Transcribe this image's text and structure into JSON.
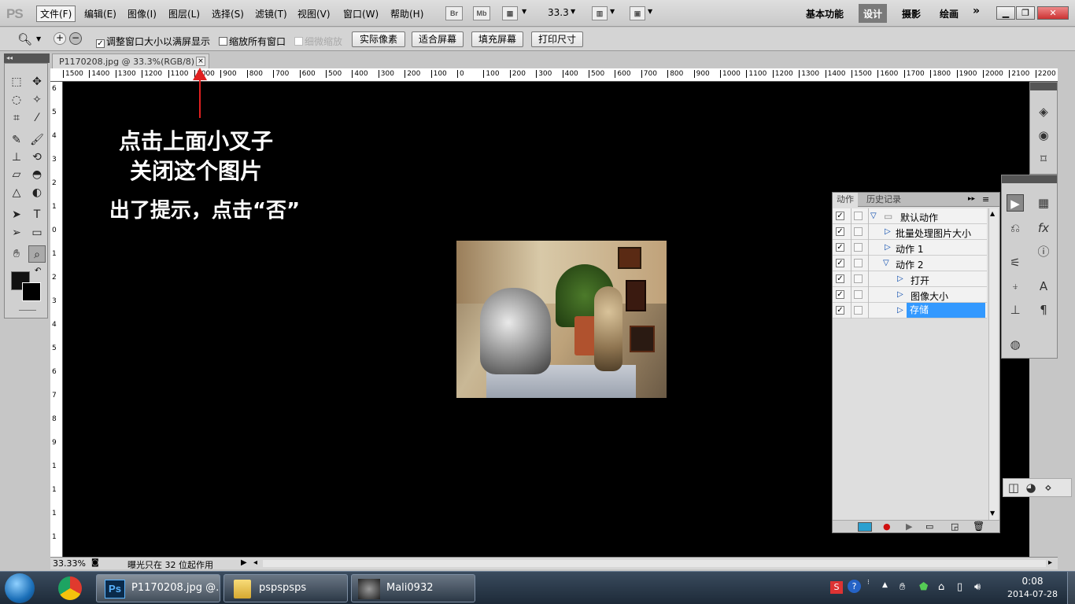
{
  "app": {
    "logo": "PS"
  },
  "menu": [
    "文件(F)",
    "编辑(E)",
    "图像(I)",
    "图层(L)",
    "选择(S)",
    "滤镜(T)",
    "视图(V)",
    "窗口(W)",
    "帮助(H)"
  ],
  "appbar": {
    "bridge": "Br",
    "minibridge": "Mb",
    "zoom": "33.3"
  },
  "workspaces": [
    "基本功能",
    "设计",
    "摄影",
    "绘画"
  ],
  "workspace_more": "»",
  "options": {
    "resize_windows": "调整窗口大小以满屏显示",
    "zoom_all": "缩放所有窗口",
    "scrubby_zoom": "细微缩放",
    "btn_actual": "实际像素",
    "btn_fit": "适合屏幕",
    "btn_fill": "填充屏幕",
    "btn_print": "打印尺寸"
  },
  "document": {
    "tab_title": "P1170208.jpg @ 33.3%(RGB/8)",
    "close": "×"
  },
  "hruler": [
    "1500",
    "1400",
    "1300",
    "1200",
    "1100",
    "1000",
    "900",
    "800",
    "700",
    "600",
    "500",
    "400",
    "300",
    "200",
    "100",
    "0",
    "100",
    "200",
    "300",
    "400",
    "500",
    "600",
    "700",
    "800",
    "900",
    "1000",
    "1100",
    "1200",
    "1300",
    "1400",
    "1500",
    "1600",
    "1700",
    "1800",
    "1900",
    "2000",
    "2100",
    "2200"
  ],
  "vruler": [
    "6",
    "5",
    "4",
    "3",
    "2",
    "1",
    "0",
    "1",
    "2",
    "3",
    "4",
    "5",
    "6",
    "7",
    "8",
    "9",
    "1",
    "1",
    "1",
    "1"
  ],
  "annotation": {
    "line1": "点击上面小叉子",
    "line2": "关闭这个图片",
    "line3": "出了提示，点击“否”"
  },
  "status": {
    "zoom": "33.33%",
    "message": "曝光只在 32 位起作用"
  },
  "actions_panel": {
    "tabs": [
      "动作",
      "历史记录"
    ],
    "rows": [
      {
        "label": "默认动作",
        "checked": true
      },
      {
        "label": "批量处理图片大小",
        "checked": true
      },
      {
        "label": "动作 1",
        "checked": true
      },
      {
        "label": "动作 2",
        "checked": true
      },
      {
        "label": "打开",
        "checked": true
      },
      {
        "label": "图像大小",
        "checked": true
      },
      {
        "label": "存储",
        "checked": true
      }
    ]
  },
  "taskbar": {
    "items": [
      "P1170208.jpg @...",
      "pspspsps",
      "Mali0932"
    ],
    "clock_time": "0:08",
    "clock_date": "2014-07-28"
  }
}
